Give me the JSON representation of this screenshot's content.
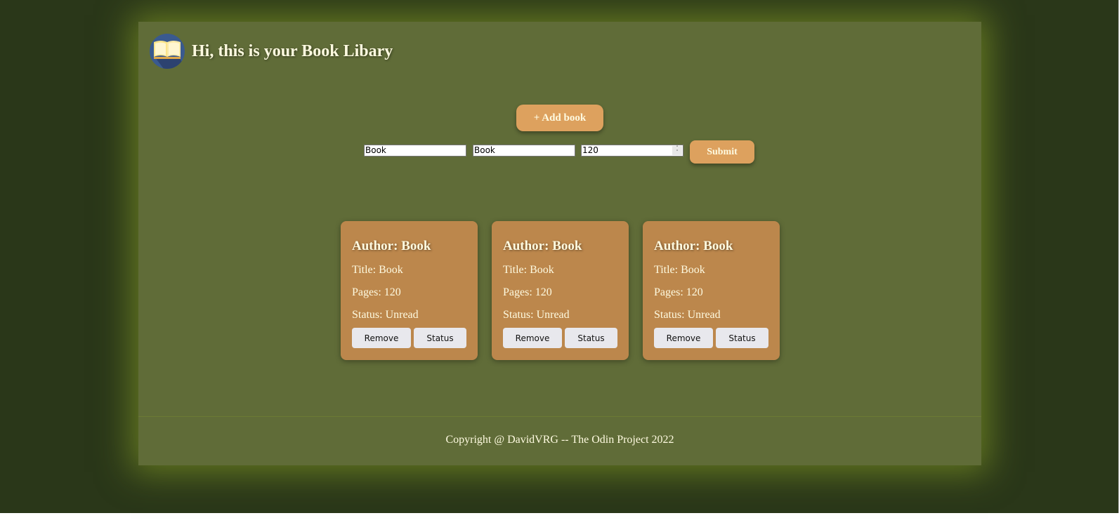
{
  "header": {
    "title": "Hi, this is your Book Libary",
    "logo_icon": "open-book-icon"
  },
  "actions": {
    "add_book_label": "+ Add book",
    "submit_label": "Submit"
  },
  "form": {
    "author_value": "Book",
    "title_value": "Book",
    "pages_value": "120"
  },
  "books": [
    {
      "author": "Author: Book",
      "title": "Title: Book",
      "pages": "Pages: 120",
      "status": "Status: Unread",
      "remove_label": "Remove",
      "status_label": "Status"
    },
    {
      "author": "Author: Book",
      "title": "Title: Book",
      "pages": "Pages: 120",
      "status": "Status: Unread",
      "remove_label": "Remove",
      "status_label": "Status"
    },
    {
      "author": "Author: Book",
      "title": "Title: Book",
      "pages": "Pages: 120",
      "status": "Status: Unread",
      "remove_label": "Remove",
      "status_label": "Status"
    }
  ],
  "footer": {
    "text": "Copyright @ DavidVRG -- The Odin Project 2022"
  },
  "colors": {
    "page_background": "#2a3719",
    "panel": "#606c38",
    "accent": "#dda15e",
    "card": "#bc874c",
    "text_light": "#fefae0"
  }
}
